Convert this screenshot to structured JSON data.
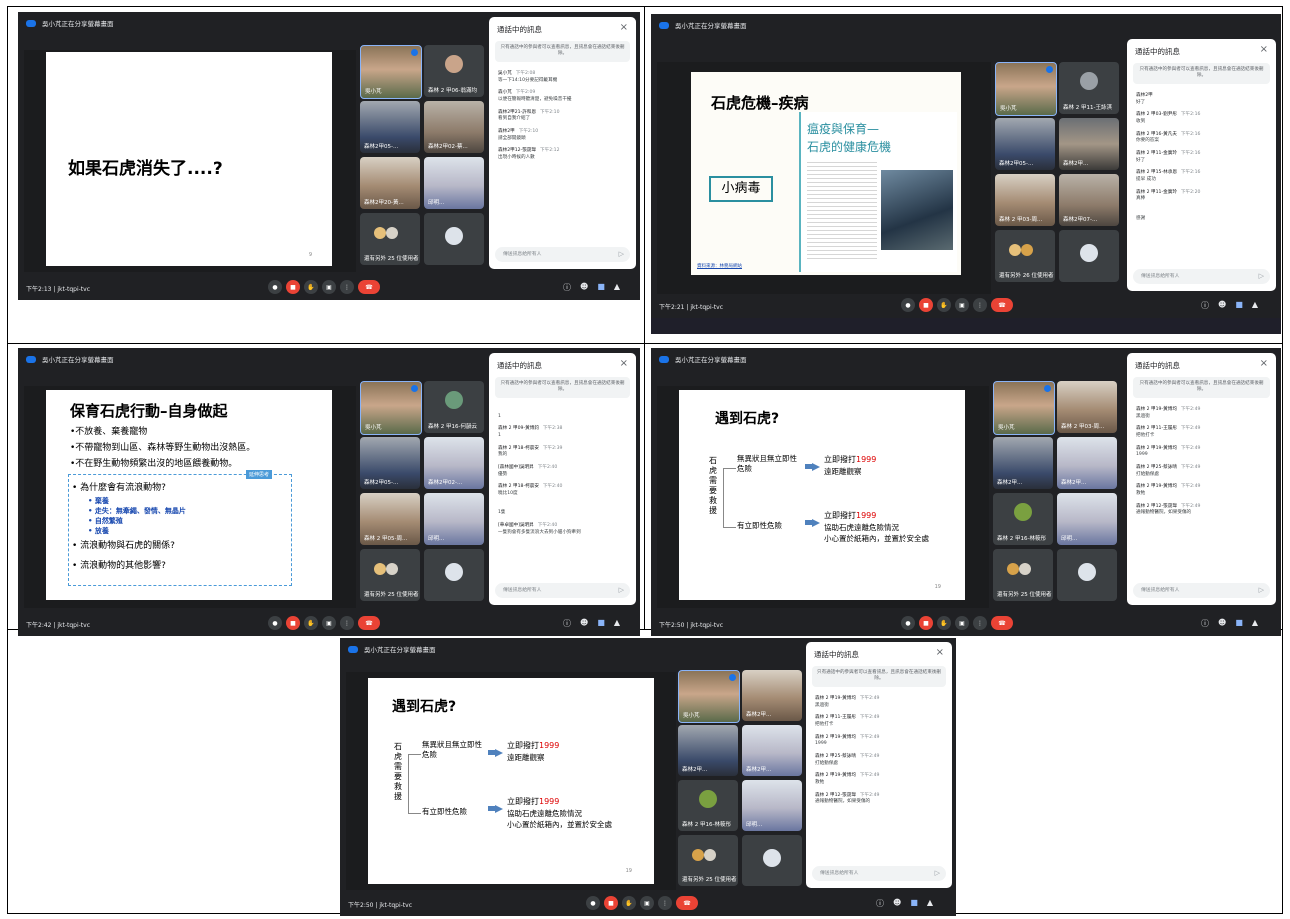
{
  "meeting": {
    "presenting_banner": "吳小芃正在分享螢幕畫面",
    "meeting_code": "jkt-tqpi-tvc",
    "chat_title": "通話中的訊息",
    "chat_notice": "只有通話中的參與者可以查看訊息，且訊息會在通話結束後刪除。",
    "chat_placeholder": "傳送訊息給所有人",
    "close_glyph": "×",
    "send_glyph": "▷",
    "more_users_25": "還有另外 25 位使用者",
    "more_users_26": "還有另外 26 位使用者",
    "accent_color": "#1a73e8",
    "end_call_color": "#ea4335"
  },
  "panels": [
    {
      "time": "下午2:13",
      "slide": {
        "title": "如果石虎消失了....?",
        "page": "9"
      },
      "tiles": [
        "吳小芃",
        "森林 2 甲06-翁滿均",
        "森林2甲05-...",
        "森林2甲02-蔡...",
        "森林2甲20-黃...",
        "邱明..."
      ],
      "chat": [
        {
          "who": "吳小芃",
          "time": "下午2:08",
          "text": "等一下14:10分要記得戴耳機"
        },
        {
          "who": "森小芃",
          "time": "下午2:09",
          "text": "以便在簡報時聽清楚，避免噪音干擾"
        },
        {
          "who": "森林2甲21-許和恩",
          "time": "下午2:10",
          "text": "看到自我介紹了"
        },
        {
          "who": "森林2甲",
          "time": "下午2:10",
          "text": "請全部開鏡頭"
        },
        {
          "who": "森林2甲12-張晟瑋",
          "time": "下午2:12",
          "text": "出現小時候的人數"
        }
      ]
    },
    {
      "time": "下午2:21",
      "slide": {
        "title": "石虎危機–疾病",
        "article_title_1": "瘟疫與保育—",
        "article_title_2": "石虎的健康危機",
        "box_label": "小病毒",
        "source": "資料來源：林務局網站"
      },
      "tiles": [
        "吳小芃",
        "森林 2 甲11-王詠淇",
        "森林2甲05-...",
        "森林2甲...",
        "森林 2 甲03-周...",
        "森林2甲07-..."
      ],
      "chat": [
        {
          "who": "森林2甲",
          "time": "",
          "text": "好了"
        },
        {
          "who": "森林 2 甲03-劉尹彤",
          "time": "下午2:16",
          "text": "收到"
        },
        {
          "who": "森林 2 甲16-黃凡夫",
          "time": "下午2:16",
          "text": "你要的答案"
        },
        {
          "who": "森林 2 甲11-金廣玲",
          "time": "下午2:16",
          "text": "好了"
        },
        {
          "who": "森林 2 甲15-林承恩",
          "time": "下午2:16",
          "text": "提早 成功"
        },
        {
          "who": "森林 2 甲11-金廣玲",
          "time": "下午2:20",
          "text": "真棒"
        },
        {
          "who": "",
          "time": "",
          "text": "感謝"
        }
      ]
    },
    {
      "time": "下午2:42",
      "slide": {
        "title": "保育石虎行動–自身做起",
        "bullets": [
          "•不放養、棄養寵物",
          "•不帶寵物到山區、森林等野生動物出沒熱區。",
          "•不在野生動物頻繁出沒的地區餵養動物。"
        ],
        "thinking_label": "延伸思考",
        "questions": [
          "• 為什麼會有流浪動物?",
          "• 流浪動物與石虎的關係?",
          "• 流浪動物的其他影響?"
        ],
        "sub_items": [
          "• 棄養",
          "• 走失：無牽繩、發情、無晶片",
          "• 自然繁殖",
          "• 放養"
        ]
      },
      "tiles": [
        "吳小芃",
        "森林 2 甲16-何韻云",
        "森林2甲05-...",
        "森林2甲02-...",
        "森林 2 甲05-周...",
        "邱明..."
      ],
      "chat": [
        {
          "who": "",
          "time": "",
          "text": "1"
        },
        {
          "who": "森林 2 甲09-黃博鈞",
          "time": "下午2:38",
          "text": "1"
        },
        {
          "who": "森林 2 甲18-柯晨安",
          "time": "下午2:39",
          "text": "我的"
        },
        {
          "who": "[森林國中]吳明昇",
          "time": "下午2:40",
          "text": "優勢"
        },
        {
          "who": "森林 2 甲18-柯晨安",
          "time": "下午2:40",
          "text": "曉比10度"
        },
        {
          "who": "",
          "time": "",
          "text": "1隻"
        },
        {
          "who": "[華卓國中]吳明昇",
          "time": "下午2:40",
          "text": "一隻狗會有多隻流浪大去到小貓小狗牽到"
        }
      ]
    },
    {
      "time": "下午2:50",
      "slide": {
        "title": "遇到石虎?",
        "side_label": "石虎需要救援",
        "branch1": "無異狀且無立即性危險",
        "branch2": "有立即性危險",
        "action1_prefix": "立即撥打",
        "action1_number": "1999",
        "action1_line2": "遠距離觀察",
        "action2_prefix": "立即撥打",
        "action2_number": "1999",
        "action2_line2": "協助石虎遠離危險情況",
        "action2_line3": "小心置於紙箱內，並置於安全處",
        "page": "19"
      },
      "tiles": [
        "吳小芃",
        "森林 2 甲03-周...",
        "森林2甲...",
        "森林2甲...",
        "森林 2 甲16-林筱彤",
        "邱明..."
      ],
      "chat": [
        {
          "who": "森林 2 甲19-黃博均",
          "time": "下午2:49",
          "text": "黑過街"
        },
        {
          "who": "森林 2 甲11-王履彤",
          "time": "下午2:49",
          "text": "把他打卡"
        },
        {
          "who": "森林 2 甲19-黃博均",
          "time": "下午2:49",
          "text": "1999"
        },
        {
          "who": "森林 2 甲25-蔡詠晴",
          "time": "下午2:49",
          "text": "打給動保處"
        },
        {
          "who": "森林 2 甲19-黃博均",
          "time": "下午2:49",
          "text": "救牠"
        },
        {
          "who": "森林 2 甲12-張晟瑋",
          "time": "下午2:49",
          "text": "通報動物醫院，如果受傷的"
        }
      ]
    },
    {
      "time": "下午2:50",
      "slide": {
        "title": "遇到石虎?",
        "side_label": "石虎需要救援",
        "branch1": "無異狀且無立即性危險",
        "branch2": "有立即性危險",
        "action1_prefix": "立即撥打",
        "action1_number": "1999",
        "action1_line2": "遠距離觀察",
        "action2_prefix": "立即撥打",
        "action2_number": "1999",
        "action2_line2": "協助石虎遠離危險情況",
        "action2_line3": "小心置於紙箱內，並置於安全處",
        "page": "19"
      },
      "tiles": [
        "吳小芃",
        "森林2甲...",
        "森林2甲...",
        "森林2甲...",
        "森林 2 甲16-林筱彤",
        "邱明..."
      ],
      "chat": [
        {
          "who": "森林 2 甲19-黃博均",
          "time": "下午2:49",
          "text": "黑過街"
        },
        {
          "who": "森林 2 甲11-王履彤",
          "time": "下午2:49",
          "text": "把他打卡"
        },
        {
          "who": "森林 2 甲19-黃博均",
          "time": "下午2:49",
          "text": "1999"
        },
        {
          "who": "森林 2 甲25-蔡詠晴",
          "time": "下午2:49",
          "text": "打給動保處"
        },
        {
          "who": "森林 2 甲19-黃博均",
          "time": "下午2:49",
          "text": "救牠"
        },
        {
          "who": "森林 2 甲12-張晟瑋",
          "time": "下午2:49",
          "text": "通報動物醫院，如果受傷的"
        }
      ]
    }
  ]
}
